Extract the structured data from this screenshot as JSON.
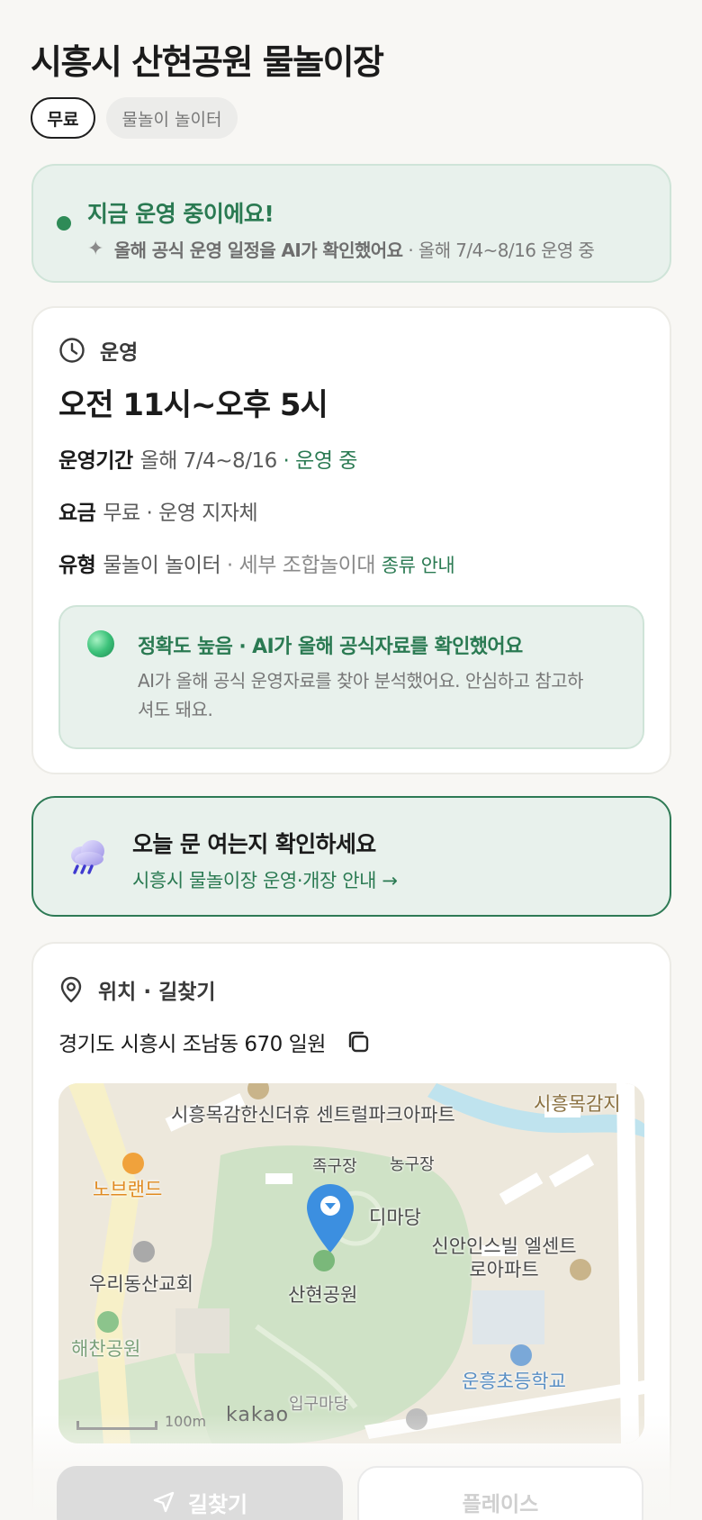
{
  "header": {
    "title": "시흥시 산현공원 물놀이장",
    "tags": [
      "무료",
      "물놀이 놀이터"
    ]
  },
  "status": {
    "title": "지금 운영 중이에요!",
    "ai_note": "올해 공식 운영 일정을 AI가 확인했어요",
    "period_note": "· 올해 7/4~8/16 운영 중",
    "color": "#2e8b57"
  },
  "operation": {
    "section_label": "운영",
    "hours": "오전 11시~오후 5시",
    "period_key": "운영기간",
    "period_value": "올해 7/4~8/16",
    "period_status": "· 운영 중",
    "fee_key": "요금",
    "fee_value": "무료 · 운영 지자체",
    "type_key": "유형",
    "type_value": "물놀이 놀이터",
    "type_detail": "· 세부 조합놀이대",
    "type_link": "종류 안내",
    "accuracy_title": "정확도 높음 · AI가 올해 공식자료를 확인했어요",
    "accuracy_desc": "AI가 올해 공식 운영자료를 찾아 분석했어요. 안심하고 참고하셔도 돼요."
  },
  "open_check": {
    "icon": "rain-cloud-icon",
    "title": "오늘 문 여는지 확인하세요",
    "link": "시흥시 물놀이장 운영·개장 안내 →"
  },
  "location": {
    "section_label": "위치 · 길찾기",
    "address": "경기도 시흥시 조남동 670 일원",
    "map": {
      "labels": {
        "apt1": "시흥목감한신더휴 센트럴파크아파트",
        "top_right": "시흥목감지",
        "nobrand": "노브랜드",
        "court1": "족구장",
        "court2": "농구장",
        "madang": "디마당",
        "church": "우리동산교회",
        "park": "산현공원",
        "apt2": "신안인스빌 엘센트로아파트",
        "park2": "해찬공원",
        "school": "운흥초등학교",
        "entrance": "입구마당"
      },
      "scale": "100m",
      "provider": "kakao"
    }
  },
  "actions": {
    "directions": "길찾기",
    "place": "플레이스"
  }
}
